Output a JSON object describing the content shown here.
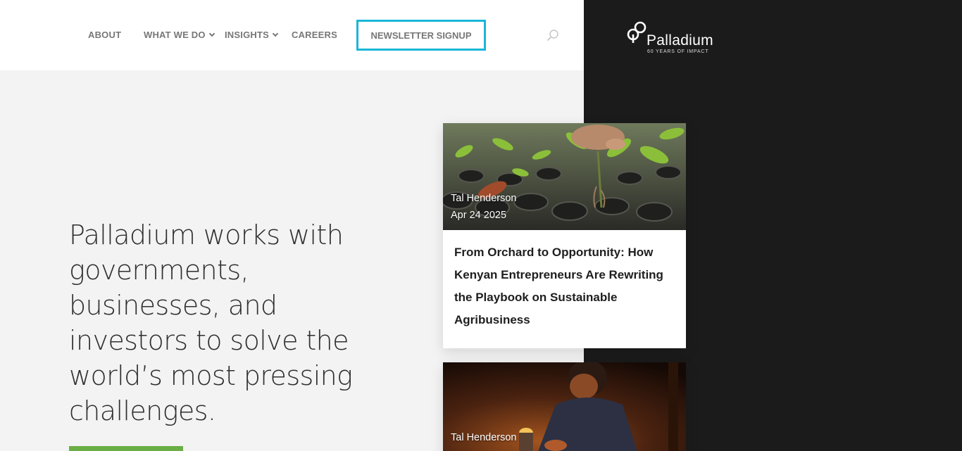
{
  "nav": {
    "items": [
      {
        "label": "ABOUT",
        "has_dropdown": false
      },
      {
        "label": "WHAT WE DO",
        "has_dropdown": true
      },
      {
        "label": "INSIGHTS",
        "has_dropdown": true
      },
      {
        "label": "CAREERS",
        "has_dropdown": false
      }
    ],
    "newsletter_label": "NEWSLETTER SIGNUP",
    "search_icon": "search-icon"
  },
  "logo": {
    "word": "Palladium",
    "tagline": "60 YEARS OF IMPACT"
  },
  "hero": {
    "text": "Palladium works with governments, businesses, and investors to solve the world’s most pressing challenges."
  },
  "cards": [
    {
      "author": "Tal Henderson",
      "date": "Apr 24 2025",
      "title": "From Orchard to Opportunity: How Kenyan Entrepreneurs Are Rewriting the Playbook on Sustainable Agribusiness",
      "image": "seedlings-photo"
    },
    {
      "author": "Tal Henderson",
      "date": "",
      "image": "child-with-lantern-photo"
    }
  ],
  "colors": {
    "accent_blue": "#19b6d8",
    "cta_green": "#6aae45",
    "dark_panel": "#1b1b1b"
  }
}
